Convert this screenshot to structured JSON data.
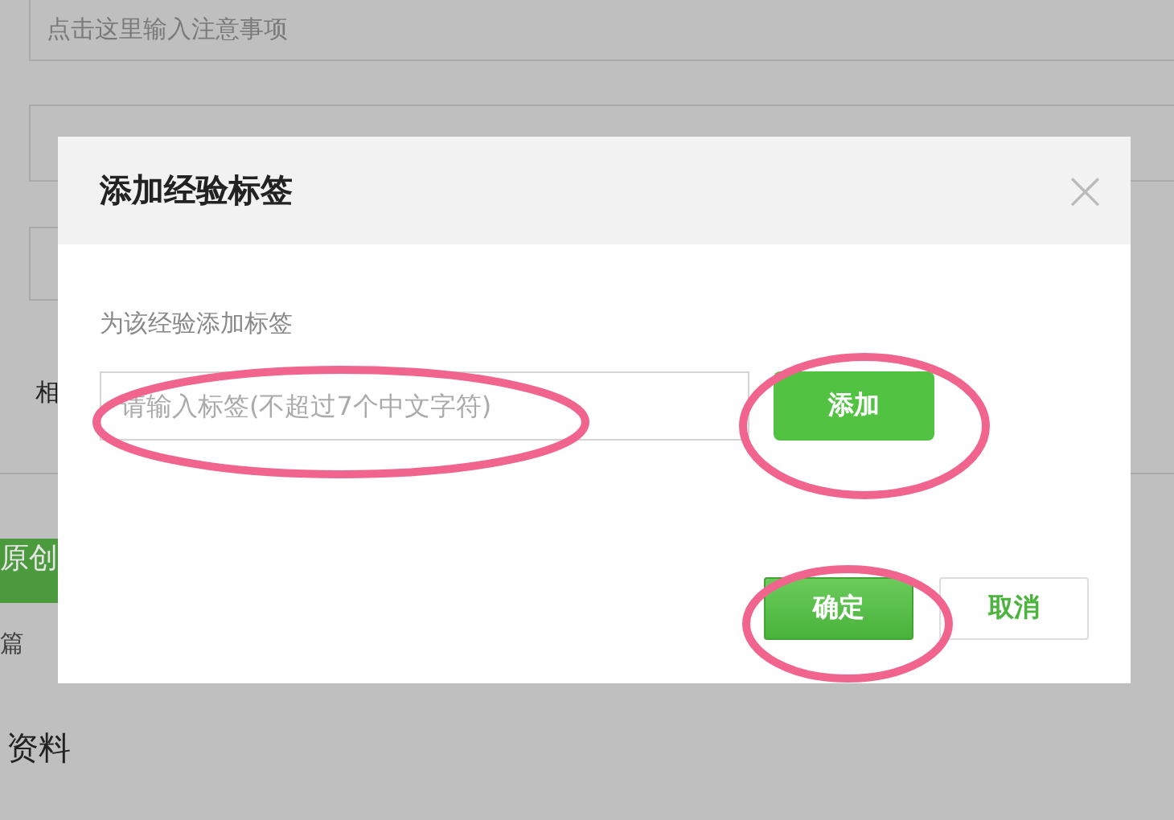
{
  "background_page": {
    "notes_field": {
      "placeholder": "点击这里输入注意事项"
    },
    "label": "相",
    "original_button": "原创",
    "count_text": "篇",
    "section_title": "资料"
  },
  "dialog": {
    "title": "添加经验标签",
    "close": "×",
    "prompt": "为该经验添加标签",
    "tag_field": {
      "placeholder": "请输入标签(不超过7个中文字符)"
    },
    "add_button": "添加",
    "buttons": [
      {
        "label": "确定",
        "kind": "primary"
      },
      {
        "label": "取消",
        "kind": "secondary"
      }
    ]
  },
  "annotations": [
    {
      "kind": "ellipse"
    },
    {
      "kind": "ellipse"
    },
    {
      "kind": "ellipse"
    }
  ]
}
